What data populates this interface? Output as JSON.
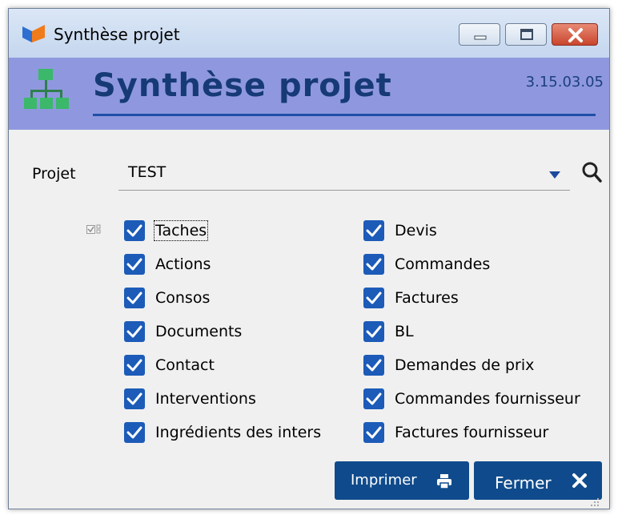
{
  "window": {
    "title": "Synthèse projet",
    "colors": {
      "header_band": "#8f98de",
      "title_blue": "#163a75",
      "checkbox": "#1c5bb8",
      "button": "#0f4b8c"
    }
  },
  "header": {
    "title": "Synthèse projet",
    "version": "3.15.03.05",
    "icon": "hierarchy-icon"
  },
  "projet": {
    "label": "Projet",
    "value": "TEST"
  },
  "options": {
    "left": [
      {
        "label": "Taches",
        "checked": true
      },
      {
        "label": "Actions",
        "checked": true
      },
      {
        "label": "Consos",
        "checked": true
      },
      {
        "label": "Documents",
        "checked": true
      },
      {
        "label": "Contact",
        "checked": true
      },
      {
        "label": "Interventions",
        "checked": true
      },
      {
        "label": "Ingrédients des inters",
        "checked": true
      }
    ],
    "right": [
      {
        "label": "Devis",
        "checked": true
      },
      {
        "label": "Commandes",
        "checked": true
      },
      {
        "label": "Factures",
        "checked": true
      },
      {
        "label": "BL",
        "checked": true
      },
      {
        "label": "Demandes de prix",
        "checked": true
      },
      {
        "label": "Commandes fournisseur",
        "checked": true
      },
      {
        "label": "Factures fournisseur",
        "checked": true
      }
    ]
  },
  "buttons": {
    "print_label": "Imprimer",
    "close_label": "Fermer"
  }
}
